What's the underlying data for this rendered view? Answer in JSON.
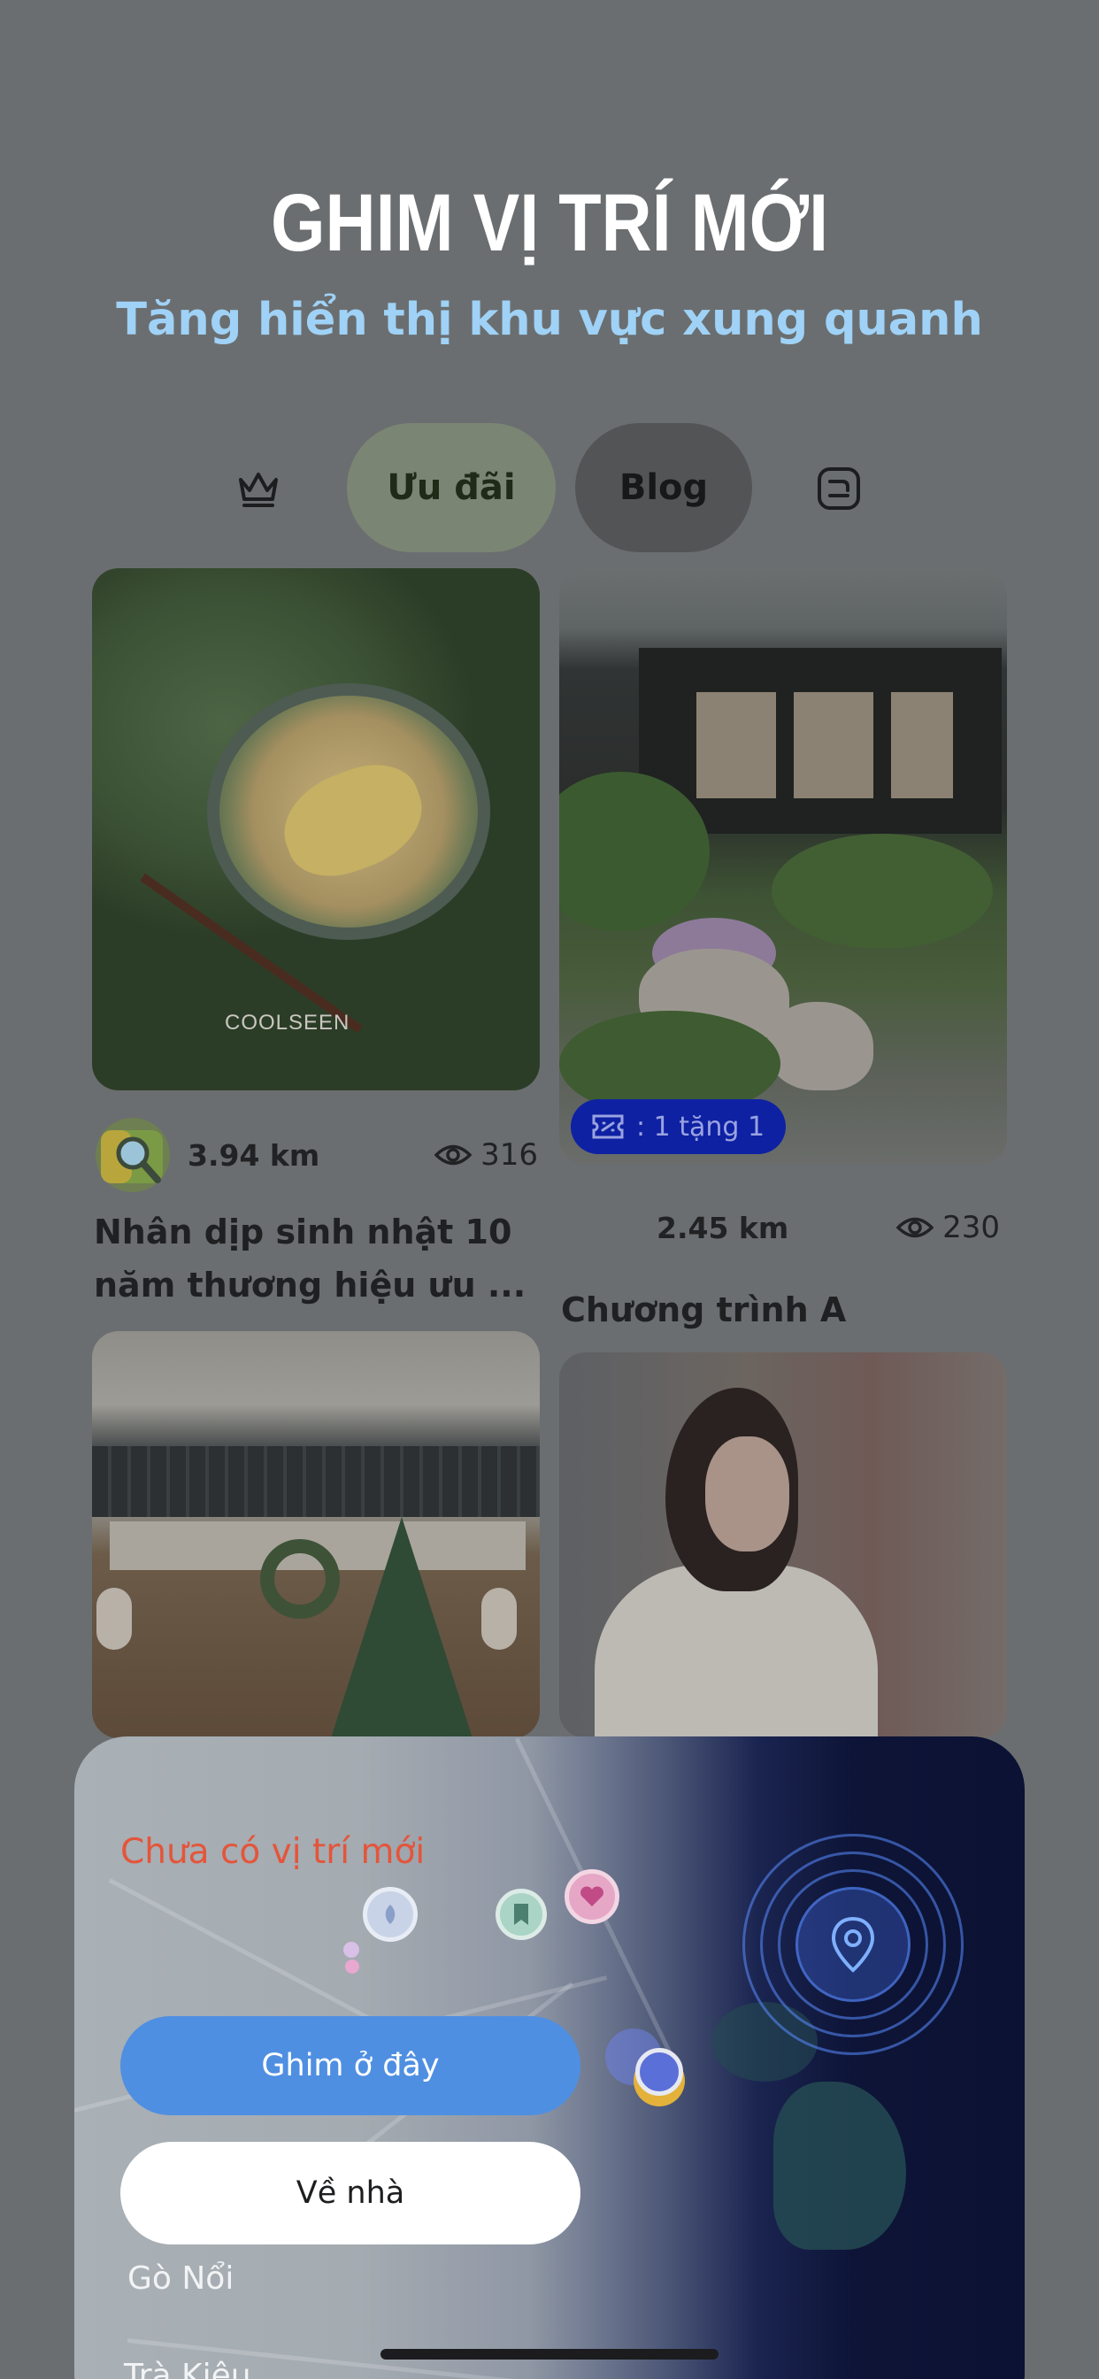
{
  "header": {
    "title": "GHIM VỊ TRÍ MỚI",
    "subtitle": "Tăng hiển thị khu vực xung quanh"
  },
  "tabs": [
    {
      "icon": "crown-icon",
      "label": ""
    },
    {
      "label": "Ưu đãi",
      "selected": false
    },
    {
      "label": "Blog",
      "selected": true
    },
    {
      "icon": "blogger-icon",
      "label": ""
    }
  ],
  "cards": [
    {
      "image": "noodle-dish",
      "watermark": "COOLSEEN",
      "distance": "3.94 km",
      "views": "316",
      "title_line1": "Nhân dịp sinh nhật 10",
      "title_line2": "năm thương hiệu ưu ..."
    },
    {
      "image": "garden-house",
      "promo": ": 1 tặng 1",
      "distance": "2.45 km",
      "views": "230",
      "title": "Chương trình A"
    },
    {
      "image": "japanese-restaurant"
    },
    {
      "image": "girl-portrait"
    }
  ],
  "sheet": {
    "warning": "Chưa có vị trí mới",
    "pin_button": "Ghim ở đây",
    "home_button": "Về nhà",
    "map_labels": [
      "Gò Nổi",
      "Trà Kiệu"
    ]
  },
  "colors": {
    "accent_blue": "#4f8fe2",
    "warning_red": "#e4553a",
    "subtitle_blue": "#9fd2f6",
    "promo_badge": "#0e21a3"
  }
}
